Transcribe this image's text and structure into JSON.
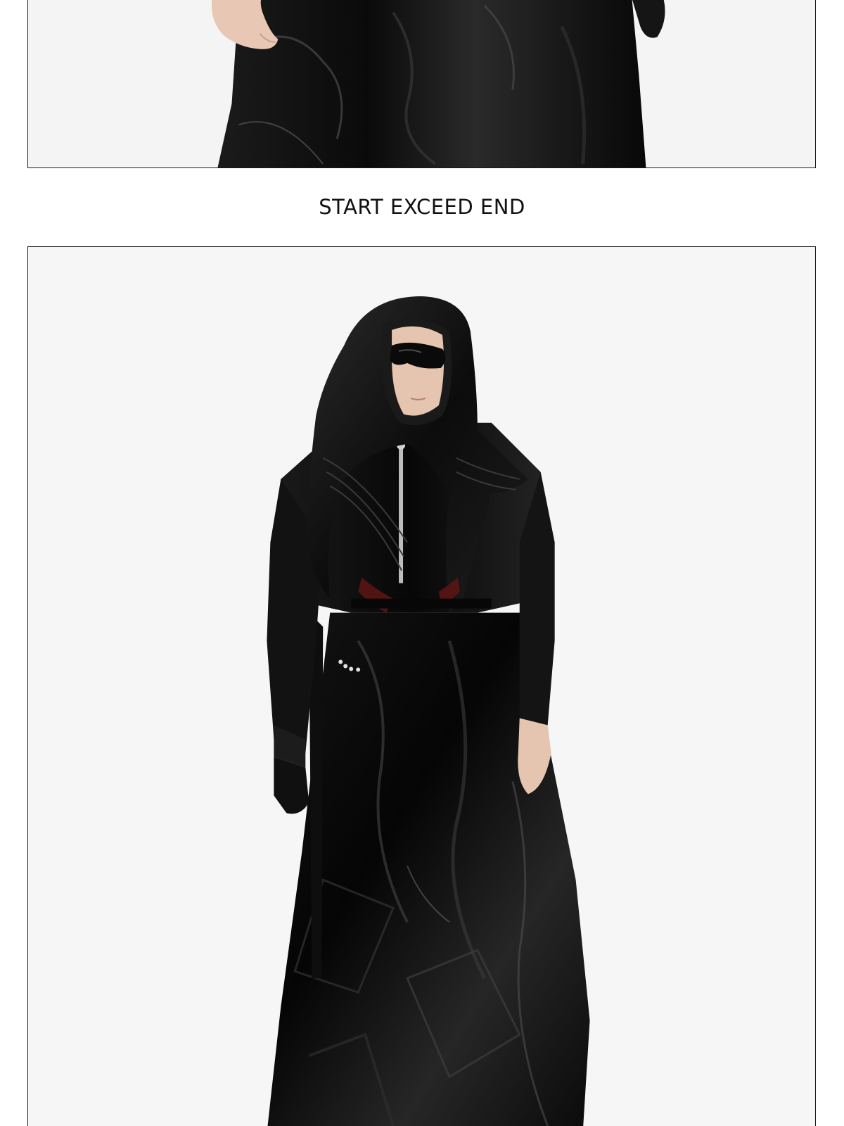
{
  "tagline": "START EXCEED END",
  "photos": {
    "top": {
      "icon": "garment-detail-photo",
      "colors": {
        "background": "#f4f4f4",
        "garment": "#0d0d0d",
        "skin": "#e8c7b4"
      }
    },
    "main": {
      "icon": "hooded-model-photo",
      "colors": {
        "background": "#f6f6f6",
        "garment": "#0b0b0b",
        "highlight": "#3a3a3a",
        "skin": "#e5c4b0"
      }
    }
  },
  "colors": {
    "background": "#ffffff",
    "text": "#111111",
    "frame": "#1a1a1a"
  }
}
